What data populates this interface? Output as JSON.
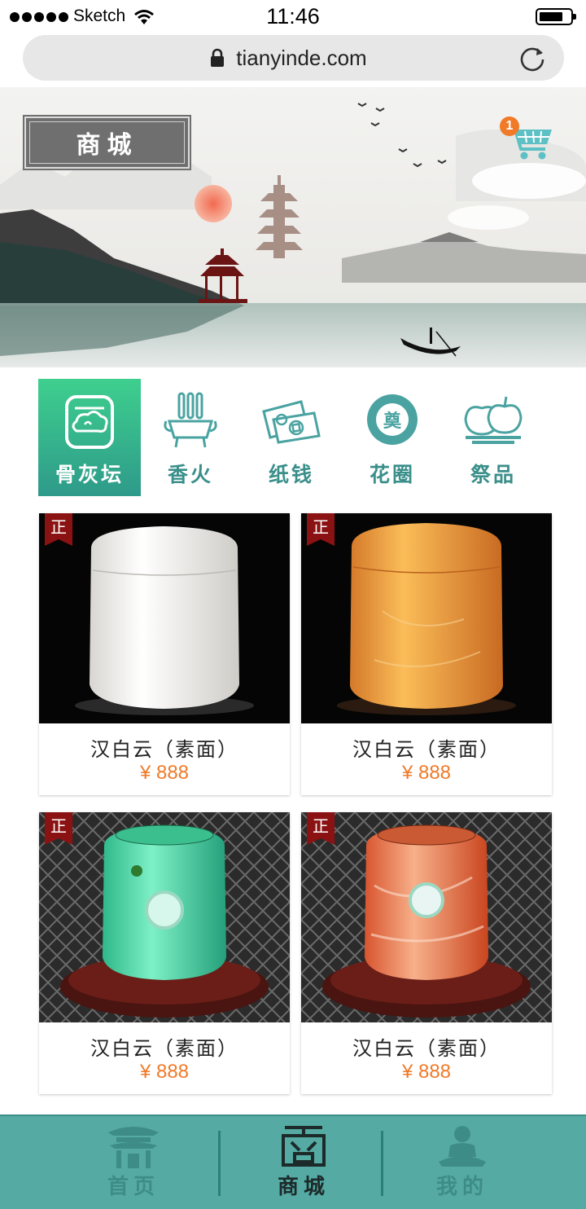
{
  "status_bar": {
    "carrier": "Sketch",
    "time": "11:46"
  },
  "url_bar": {
    "url": "tianyinde.com"
  },
  "banner": {
    "title": "商城",
    "cart_count": "1"
  },
  "categories": [
    {
      "label": "骨灰坛",
      "icon": "urn-cloud-icon",
      "active": true
    },
    {
      "label": "香火",
      "icon": "incense-burner-icon",
      "active": false
    },
    {
      "label": "纸钱",
      "icon": "paper-money-icon",
      "active": false
    },
    {
      "label": "花圈",
      "icon": "wreath-icon",
      "active": false
    },
    {
      "label": "祭品",
      "icon": "fruit-plate-icon",
      "active": false
    }
  ],
  "products": [
    {
      "tag": "正",
      "name": "汉白云（素面）",
      "price": "¥ 888",
      "urn_color": "#f2f0ec"
    },
    {
      "tag": "正",
      "name": "汉白云（素面）",
      "price": "¥ 888",
      "urn_color": "#f4a83a"
    },
    {
      "tag": "正",
      "name": "汉白云（素面）",
      "price": "¥ 888",
      "urn_color": "#5fe0b0"
    },
    {
      "tag": "正",
      "name": "汉白云（素面）",
      "price": "¥ 888",
      "urn_color": "#ec8a5a"
    }
  ],
  "bottom_nav": [
    {
      "label": "首页",
      "icon": "pagoda-home-icon",
      "active": false
    },
    {
      "label": "商城",
      "icon": "shop-icon",
      "active": true
    },
    {
      "label": "我的",
      "icon": "meditating-person-icon",
      "active": false
    }
  ],
  "colors": {
    "accent": "#55aaa4",
    "price": "#f07a28",
    "tag": "#8b1212"
  }
}
